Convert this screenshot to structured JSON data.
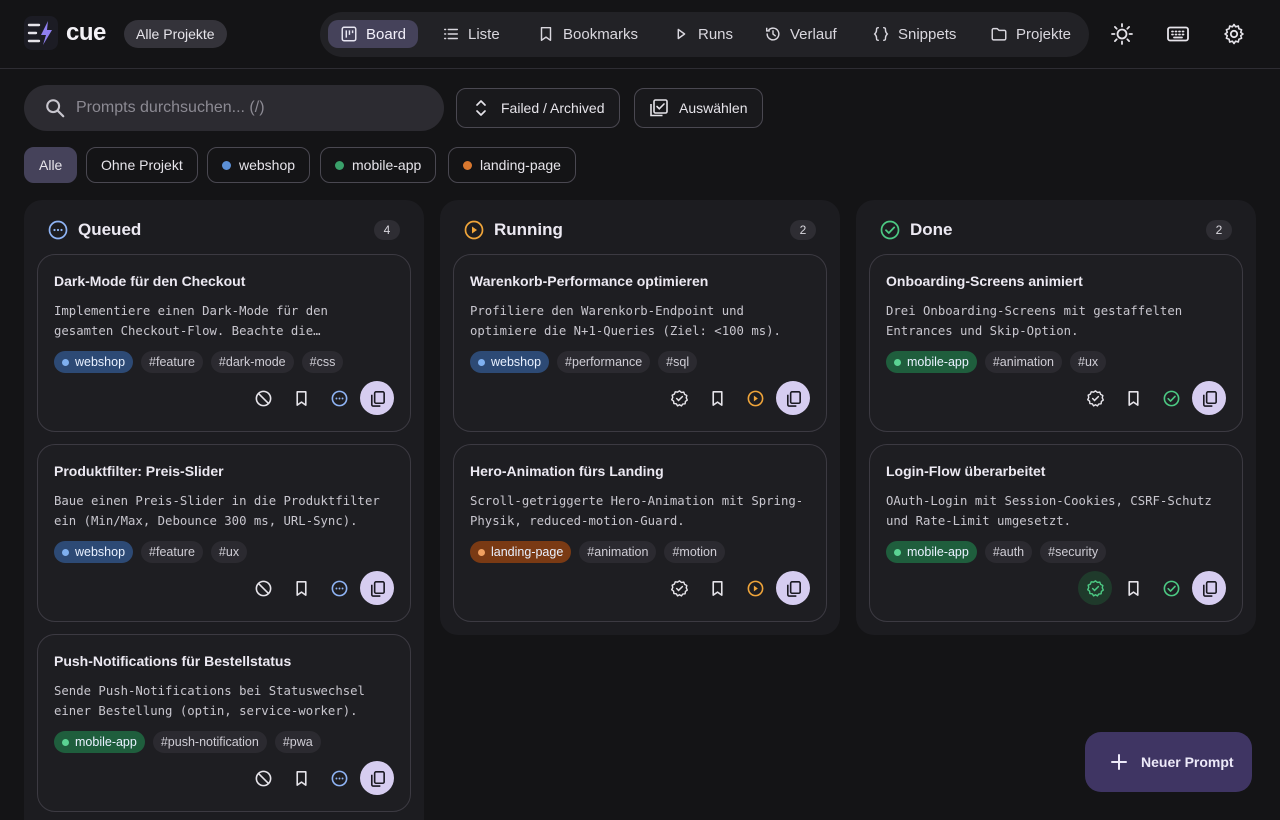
{
  "app": {
    "brand": "cue",
    "project_pill": "Alle Projekte"
  },
  "nav": [
    {
      "label": "Board",
      "icon": "board-icon",
      "active": true
    },
    {
      "label": "Liste",
      "icon": "list-icon"
    },
    {
      "label": "Bookmarks",
      "icon": "bookmark-icon"
    },
    {
      "label": "Runs",
      "icon": "play-icon"
    },
    {
      "label": "Verlauf",
      "icon": "history-icon"
    },
    {
      "label": "Snippets",
      "icon": "code-braces-icon"
    },
    {
      "label": "Projekte",
      "icon": "folder-icon"
    }
  ],
  "header_icons": [
    "sun-icon",
    "keyboard-icon",
    "gear-icon"
  ],
  "search": {
    "placeholder": "Prompts durchsuchen... (/)"
  },
  "toolbar": {
    "failed_archived": "Failed / Archived",
    "select": "Auswählen"
  },
  "filters": [
    {
      "label": "Alle",
      "active": true
    },
    {
      "label": "Ohne Projekt"
    },
    {
      "label": "webshop",
      "color": "#5b8fd6"
    },
    {
      "label": "mobile-app",
      "color": "#3aa06a"
    },
    {
      "label": "landing-page",
      "color": "#d9782f"
    }
  ],
  "colors": {
    "webshop_bg": "#2d4a75",
    "mobile_bg": "#1f5e3d",
    "landing_bg": "#7a3a14",
    "queued": "#8fb4f5",
    "running": "#f0a53a",
    "done": "#4cc983",
    "accent": "#d6cdf0"
  },
  "columns": [
    {
      "title": "Queued",
      "count": "4",
      "cards": [
        {
          "title": "Dark-Mode für den Checkout",
          "desc": "Implementiere einen Dark-Mode für den\ngesamten Checkout-Flow. Beachte die…",
          "project": "webshop",
          "tags": [
            "#feature",
            "#dark-mode",
            "#css"
          ]
        },
        {
          "title": "Produktfilter: Preis-Slider",
          "desc": "Baue einen Preis-Slider in die Produktfilter\nein (Min/Max, Debounce 300 ms, URL-Sync).",
          "project": "webshop",
          "tags": [
            "#feature",
            "#ux"
          ]
        },
        {
          "title": "Push-Notifications für Bestellstatus",
          "desc": "Sende Push-Notifications bei Statuswechsel\neiner Bestellung (optin, service-worker).",
          "project": "mobile-app",
          "tags": [
            "#push-notification",
            "#pwa"
          ]
        }
      ]
    },
    {
      "title": "Running",
      "count": "2",
      "cards": [
        {
          "title": "Warenkorb-Performance optimieren",
          "desc": "Profiliere den Warenkorb-Endpoint und\noptimiere die N+1-Queries (Ziel: <100 ms).",
          "project": "webshop",
          "tags": [
            "#performance",
            "#sql"
          ]
        },
        {
          "title": "Hero-Animation fürs Landing",
          "desc": "Scroll-getriggerte Hero-Animation mit Spring-\nPhysik, reduced-motion-Guard.",
          "project": "landing-page",
          "tags": [
            "#animation",
            "#motion"
          ]
        }
      ]
    },
    {
      "title": "Done",
      "count": "2",
      "cards": [
        {
          "title": "Onboarding-Screens animiert",
          "desc": "Drei Onboarding-Screens mit gestaffelten\nEntrances und Skip-Option.",
          "project": "mobile-app",
          "tags": [
            "#animation",
            "#ux"
          ]
        },
        {
          "title": "Login-Flow überarbeitet",
          "desc": "OAuth-Login mit Session-Cookies, CSRF-Schutz\nund Rate-Limit umgesetzt.",
          "project": "mobile-app",
          "tags": [
            "#auth",
            "#security"
          ]
        }
      ]
    }
  ],
  "fab": {
    "label": "Neuer Prompt"
  }
}
